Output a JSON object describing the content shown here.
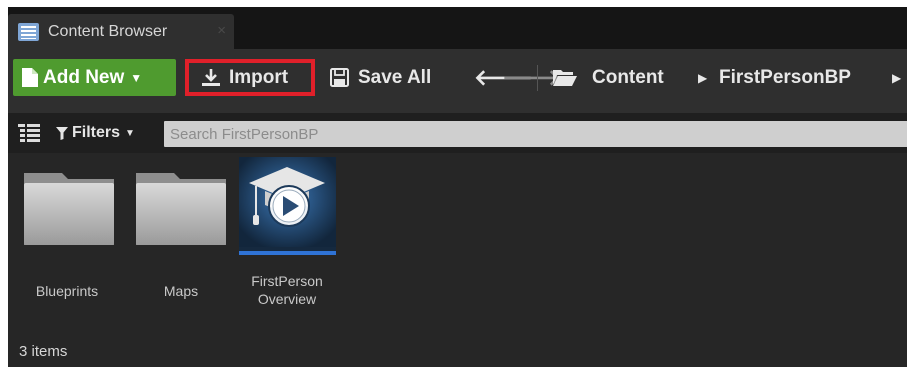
{
  "tab": {
    "title": "Content Browser",
    "close": "×"
  },
  "toolbar": {
    "add_new": "Add New",
    "import": "Import",
    "save_all": "Save All",
    "breadcrumb": [
      "Content",
      "FirstPersonBP"
    ]
  },
  "filters": {
    "label": "Filters",
    "search_placeholder": "Search FirstPersonBP"
  },
  "assets": [
    {
      "label": "Blueprints"
    },
    {
      "label": "Maps"
    },
    {
      "label_line1": "FirstPerson",
      "label_line2": "Overview"
    }
  ],
  "status": {
    "item_count": "3 items"
  },
  "colors": {
    "add_new_green": "#4f9b2f",
    "import_highlight": "#e0202a",
    "selection_blue": "#2f73d6"
  }
}
